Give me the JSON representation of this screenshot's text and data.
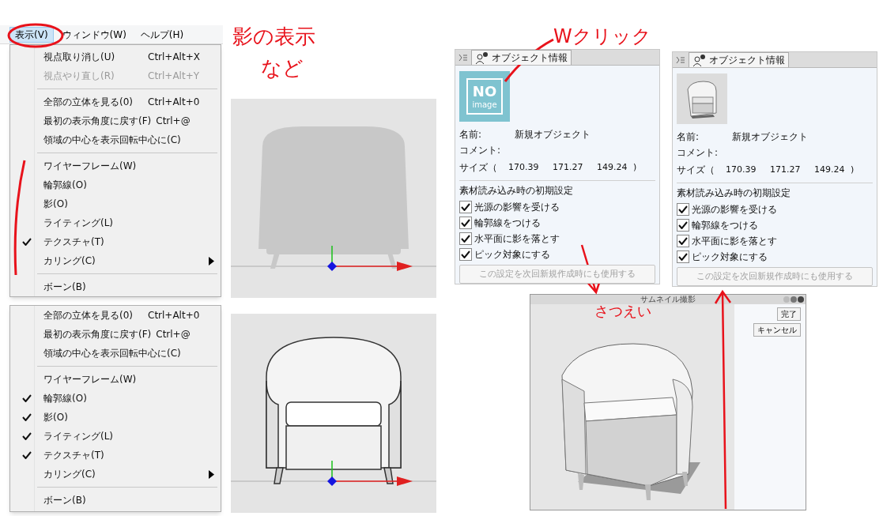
{
  "menus": [
    {
      "menubar": [
        {
          "label": "表示(V)",
          "selected": true
        },
        {
          "label": "ウィンドウ(W)",
          "selected": false
        },
        {
          "label": "ヘルプ(H)",
          "selected": false
        }
      ],
      "items": [
        {
          "kind": "command",
          "label": "視点取り消し(U)",
          "shortcut": "Ctrl+Alt+X",
          "disabled": false
        },
        {
          "kind": "command",
          "label": "視点やり直し(R)",
          "shortcut": "Ctrl+Alt+Y",
          "disabled": true
        },
        {
          "kind": "separator"
        },
        {
          "kind": "command",
          "label": "全部の立体を見る(0)",
          "shortcut": "Ctrl+Alt+0",
          "disabled": false
        },
        {
          "kind": "command",
          "label": "最初の表示角度に戻す(F)",
          "shortcut": "Ctrl+@",
          "disabled": false
        },
        {
          "kind": "command",
          "label": "領域の中心を表示回転中心に(C)",
          "disabled": false
        },
        {
          "kind": "separator"
        },
        {
          "kind": "toggle",
          "label": "ワイヤーフレーム(W)",
          "checked": false
        },
        {
          "kind": "toggle",
          "label": "輪郭線(O)",
          "checked": false
        },
        {
          "kind": "toggle",
          "label": "影(O)",
          "checked": false
        },
        {
          "kind": "toggle",
          "label": "ライティング(L)",
          "checked": false
        },
        {
          "kind": "toggle",
          "label": "テクスチャ(T)",
          "checked": true
        },
        {
          "kind": "submenu",
          "label": "カリング(C)"
        },
        {
          "kind": "separator"
        },
        {
          "kind": "command",
          "label": "ボーン(B)",
          "disabled": false
        }
      ]
    },
    {
      "items": [
        {
          "kind": "command",
          "label": "全部の立体を見る(0)",
          "shortcut": "Ctrl+Alt+0",
          "disabled": false
        },
        {
          "kind": "command",
          "label": "最初の表示角度に戻す(F)",
          "shortcut": "Ctrl+@",
          "disabled": false
        },
        {
          "kind": "command",
          "label": "領域の中心を表示回転中心に(C)",
          "disabled": false
        },
        {
          "kind": "separator"
        },
        {
          "kind": "toggle",
          "label": "ワイヤーフレーム(W)",
          "checked": false
        },
        {
          "kind": "toggle",
          "label": "輪郭線(O)",
          "checked": true
        },
        {
          "kind": "toggle",
          "label": "影(O)",
          "checked": true
        },
        {
          "kind": "toggle",
          "label": "ライティング(L)",
          "checked": true
        },
        {
          "kind": "toggle",
          "label": "テクスチャ(T)",
          "checked": true
        },
        {
          "kind": "submenu",
          "label": "カリング(C)"
        },
        {
          "kind": "separator"
        },
        {
          "kind": "command",
          "label": "ボーン(B)",
          "disabled": false
        }
      ]
    }
  ],
  "object_panels": [
    {
      "tab": "オブジェクト情報",
      "thumbnail": {
        "kind": "no_image",
        "big": "NO",
        "small": "image"
      },
      "name_label": "名前:",
      "name_value": "新規オブジェクト",
      "comment_label": "コメント:",
      "size_label": "サイズ（",
      "size_values": [
        "170.39",
        "171.27",
        "149.24"
      ],
      "size_close": ")",
      "section": "素材読み込み時の初期設定",
      "options": [
        {
          "label": "光源の影響を受ける",
          "checked": true
        },
        {
          "label": "輪郭線をつける",
          "checked": true
        },
        {
          "label": "水平面に影を落とす",
          "checked": true
        },
        {
          "label": "ピック対象にする",
          "checked": true
        }
      ],
      "button": {
        "label": "この設定を次回新規作成時にも使用する",
        "disabled": true
      }
    },
    {
      "tab": "オブジェクト情報",
      "thumbnail": {
        "kind": "chair"
      },
      "name_label": "名前:",
      "name_value": "新規オブジェクト",
      "comment_label": "コメント:",
      "size_label": "サイズ（",
      "size_values": [
        "170.39",
        "171.27",
        "149.24"
      ],
      "size_close": ")",
      "section": "素材読み込み時の初期設定",
      "options": [
        {
          "label": "光源の影響を受ける",
          "checked": true
        },
        {
          "label": "輪郭線をつける",
          "checked": true
        },
        {
          "label": "水平面に影を落とす",
          "checked": true
        },
        {
          "label": "ピック対象にする",
          "checked": true
        }
      ],
      "button": {
        "label": "この設定を次回新規作成時にも使用する",
        "disabled": true
      }
    }
  ],
  "thumbnail_window": {
    "title": "サムネイル撮影",
    "buttons": [
      "完了",
      "キャンセル"
    ]
  },
  "annotations": {
    "shadow_note": [
      "影の表示",
      "など"
    ],
    "click_note": "Wクリック",
    "shoot_note": "さつえい"
  }
}
